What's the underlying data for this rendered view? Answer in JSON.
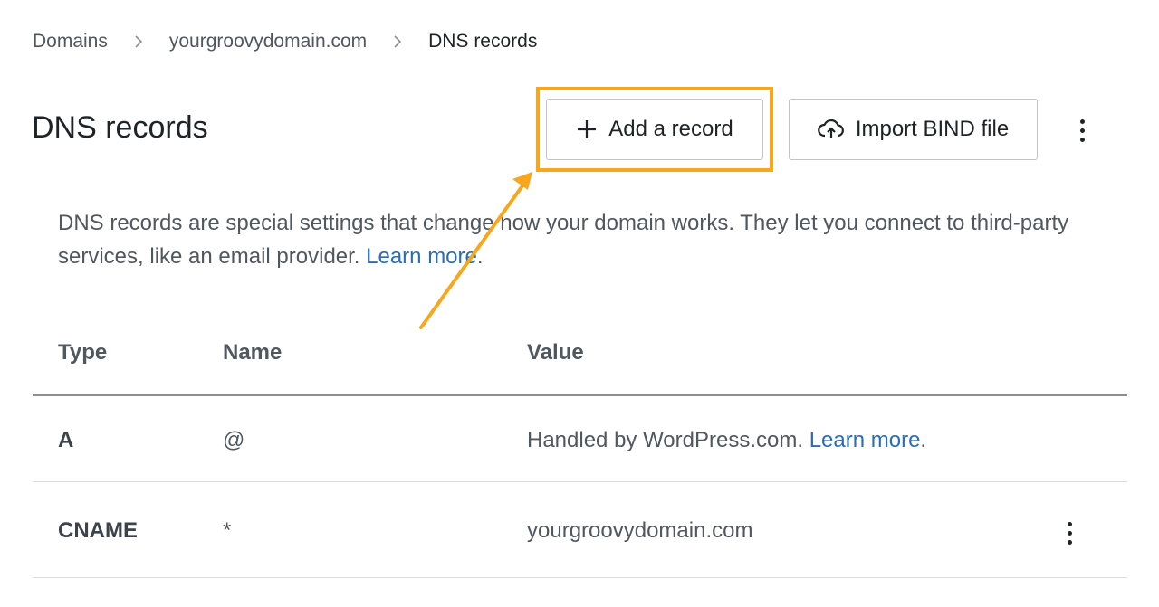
{
  "breadcrumb": {
    "items": [
      "Domains",
      "yourgroovydomain.com",
      "DNS records"
    ]
  },
  "page_title": "DNS records",
  "toolbar": {
    "add_record_label": "Add a record",
    "import_bind_label": "Import BIND file"
  },
  "icons": {
    "add": "plus-icon",
    "import": "cloud-upload-icon",
    "more": "more-vertical-icon",
    "separator": "chevron-right-icon"
  },
  "description": {
    "text": "DNS records are special settings that change how your domain works. They let you connect to third-party services, like an email provider. ",
    "link": "Learn more",
    "suffix": "."
  },
  "table": {
    "columns": [
      "Type",
      "Name",
      "Value"
    ],
    "rows": [
      {
        "type": "A",
        "name": "@",
        "value": "Handled by WordPress.com. ",
        "value_link": "Learn more",
        "value_suffix": "."
      },
      {
        "type": "CNAME",
        "name": "*",
        "value": "yourgroovydomain.com"
      }
    ]
  },
  "colors": {
    "annotation": "#f6a71e",
    "link": "#2b6db3",
    "text": "#1d2327",
    "muted_text": "#50575e"
  }
}
